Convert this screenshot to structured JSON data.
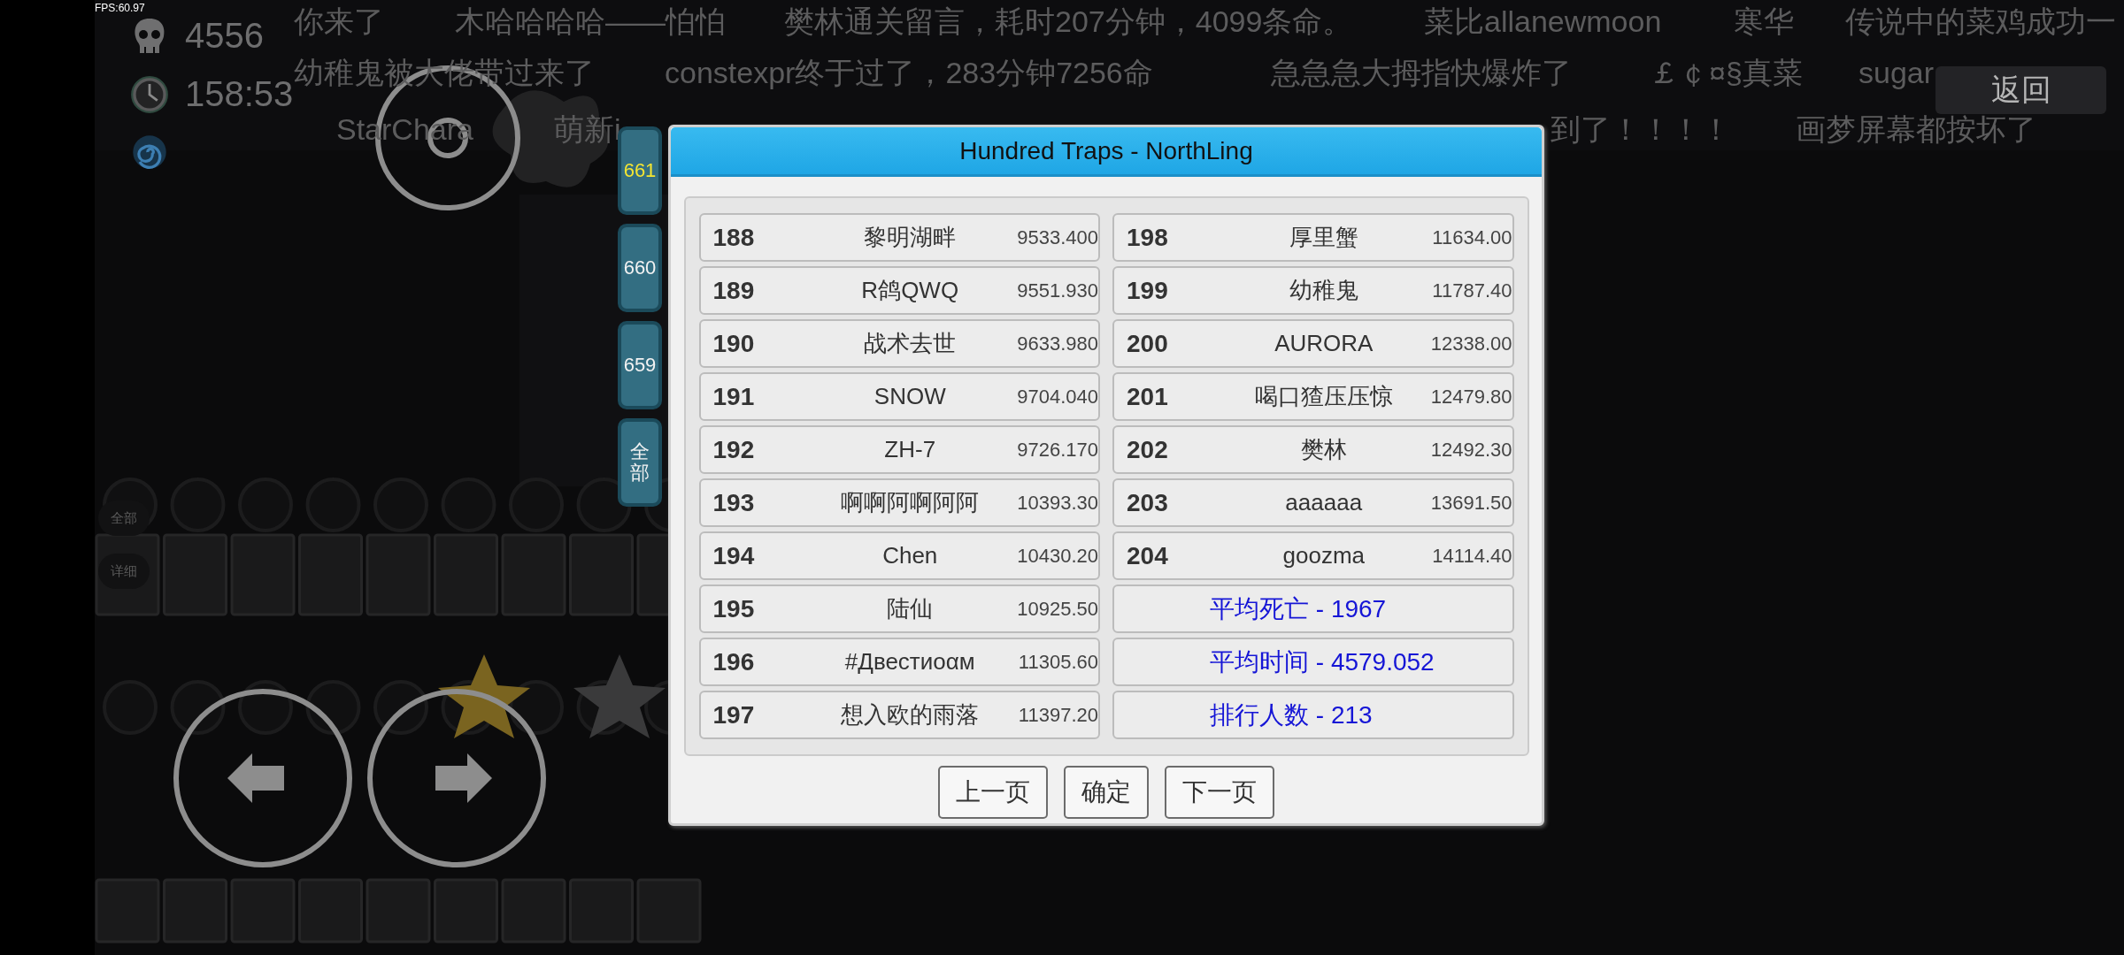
{
  "fps": "FPS:60.97",
  "stats": [
    {
      "kind": "deaths",
      "value": "4556"
    },
    {
      "kind": "time",
      "value": "158:53"
    },
    {
      "kind": "spiral"
    }
  ],
  "comments": [
    [
      "你来了",
      "木哈哈哈哈——怕怕",
      "樊林通关留言，耗时207分钟，4099条命。",
      "菜比allanewmoon",
      "寒华",
      "传说中的菜鸡成功一"
    ],
    [
      "幼稚鬼被大佬带过来了",
      "constexpr终于过了，283分钟7256命",
      "急急急大拇指快爆炸了",
      "￡￠¤§真菜",
      "sugar"
    ],
    [
      "StarChara",
      "萌新i",
      "到了！！！！",
      "画梦屏幕都按坏了"
    ]
  ],
  "side_buttons": [
    "全部",
    "详细"
  ],
  "back_button": "返回",
  "page_tabs": [
    {
      "label": "661",
      "selected": true
    },
    {
      "label": "660",
      "selected": false
    },
    {
      "label": "659",
      "selected": false
    },
    {
      "label": "全部",
      "selected": false
    }
  ],
  "dialog": {
    "title": "Hundred Traps - NorthLing",
    "columns": [
      [
        {
          "kind": "rank",
          "rank": "188",
          "name": "黎明湖畔",
          "score": "9533.400"
        },
        {
          "kind": "rank",
          "rank": "189",
          "name": "R鸽QWQ",
          "score": "9551.930"
        },
        {
          "kind": "rank",
          "rank": "190",
          "name": "战术去世",
          "score": "9633.980"
        },
        {
          "kind": "rank",
          "rank": "191",
          "name": "SNOW",
          "score": "9704.040"
        },
        {
          "kind": "rank",
          "rank": "192",
          "name": "ZH-7",
          "score": "9726.170"
        },
        {
          "kind": "rank",
          "rank": "193",
          "name": "啊啊阿啊阿阿",
          "score": "10393.30"
        },
        {
          "kind": "rank",
          "rank": "194",
          "name": "Chen",
          "score": "10430.20"
        },
        {
          "kind": "rank",
          "rank": "195",
          "name": "陆仙",
          "score": "10925.50"
        },
        {
          "kind": "rank",
          "rank": "196",
          "name": "#Двестиоαм",
          "score": "11305.60"
        },
        {
          "kind": "rank",
          "rank": "197",
          "name": "想入欧的雨落",
          "score": "11397.20"
        }
      ],
      [
        {
          "kind": "rank",
          "rank": "198",
          "name": "厚里蟹",
          "score": "11634.00"
        },
        {
          "kind": "rank",
          "rank": "199",
          "name": "幼稚鬼",
          "score": "11787.40"
        },
        {
          "kind": "rank",
          "rank": "200",
          "name": "AURORA",
          "score": "12338.00"
        },
        {
          "kind": "rank",
          "rank": "201",
          "name": "喝口猹压压惊",
          "score": "12479.80"
        },
        {
          "kind": "rank",
          "rank": "202",
          "name": "樊林",
          "score": "12492.30"
        },
        {
          "kind": "rank",
          "rank": "203",
          "name": "aaaaaa",
          "score": "13691.50"
        },
        {
          "kind": "rank",
          "rank": "204",
          "name": "goozma",
          "score": "14114.40"
        },
        {
          "kind": "stat",
          "text": "平均死亡 - 1967"
        },
        {
          "kind": "stat",
          "text": "平均时间 - 4579.052"
        },
        {
          "kind": "stat",
          "text": "排行人数 - 213"
        }
      ]
    ],
    "buttons": [
      "上一页",
      "确定",
      "下一页"
    ]
  }
}
